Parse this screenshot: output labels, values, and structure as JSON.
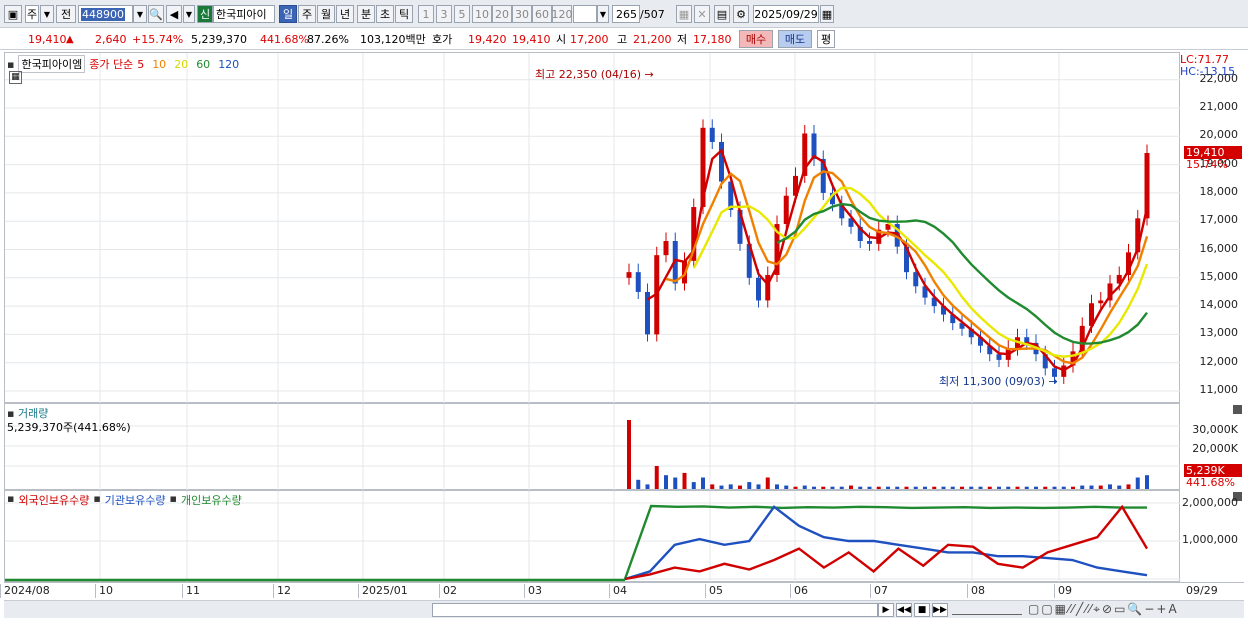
{
  "toolbar": {
    "market": "주",
    "prev_btn": "전",
    "code": "448900",
    "new_badge": "신",
    "stock_name": "한국피아이",
    "periods": [
      "일",
      "주",
      "월",
      "년",
      "분",
      "초",
      "틱"
    ],
    "minutes": [
      "1",
      "3",
      "5",
      "10",
      "20",
      "30",
      "60",
      "120"
    ],
    "count": "265",
    "count_total": "/507",
    "date": "2025/09/29"
  },
  "infobar": {
    "price": "19,410",
    "change": "2,640",
    "change_pct": "+15.74%",
    "volume": "5,239,370",
    "vol_ratio": "441.68%",
    "vol_ratio2": "87.26%",
    "amount": "103,120백만",
    "ask_label": "호가",
    "ask1": "19,420",
    "bid1": "19,410",
    "open_label": "시",
    "open": "17,200",
    "high_label": "고",
    "high": "21,200",
    "low_label": "저",
    "low": "17,180",
    "buy": "매수",
    "sell": "매도",
    "avg": "평"
  },
  "price_panel": {
    "name": "한국피아이엠",
    "legend_prefix": "종가 단순",
    "ma_periods": [
      "5",
      "10",
      "20",
      "60",
      "120"
    ],
    "ma_colors": [
      "#d00000",
      "#f08000",
      "#e8e800",
      "#208a30",
      "#1e50c0"
    ],
    "high_note": "최고 22,350 (04/16)",
    "low_note": "최저 11,300 (09/03)",
    "lc": "LC:71.77",
    "hc": "HC:-13.15",
    "y_ticks": [
      "22,000",
      "21,000",
      "20,000",
      "19,000",
      "18,000",
      "17,000",
      "16,000",
      "15,000",
      "14,000",
      "13,000",
      "12,000",
      "11,000"
    ],
    "last_price": "19,410",
    "last_pct": "15.74%"
  },
  "volume_panel": {
    "title": "거래량",
    "value": "5,239,370주(441.68%)",
    "y_ticks": [
      "30,000K",
      "20,000K"
    ],
    "last": "5,239K",
    "last_pct": "441.68%"
  },
  "holding_panel": {
    "series": [
      "외국인보유수량",
      "기관보유수량",
      "개인보유수량"
    ],
    "series_colors": [
      "#d00000",
      "#1e50c0",
      "#208a30"
    ],
    "y_ticks": [
      "2,000,000",
      "1,000,000"
    ]
  },
  "x_labels": [
    "2024/08",
    "10",
    "11",
    "12",
    "2025/01",
    "02",
    "03",
    "04",
    "05",
    "06",
    "07",
    "08",
    "09",
    "09/29"
  ],
  "chart_data": {
    "type": "candlestick",
    "price_range": [
      11000,
      22500
    ],
    "high": {
      "value": 22350,
      "date": "04/16"
    },
    "low": {
      "value": 11300,
      "date": "09/03"
    },
    "last_close": 19410
  }
}
